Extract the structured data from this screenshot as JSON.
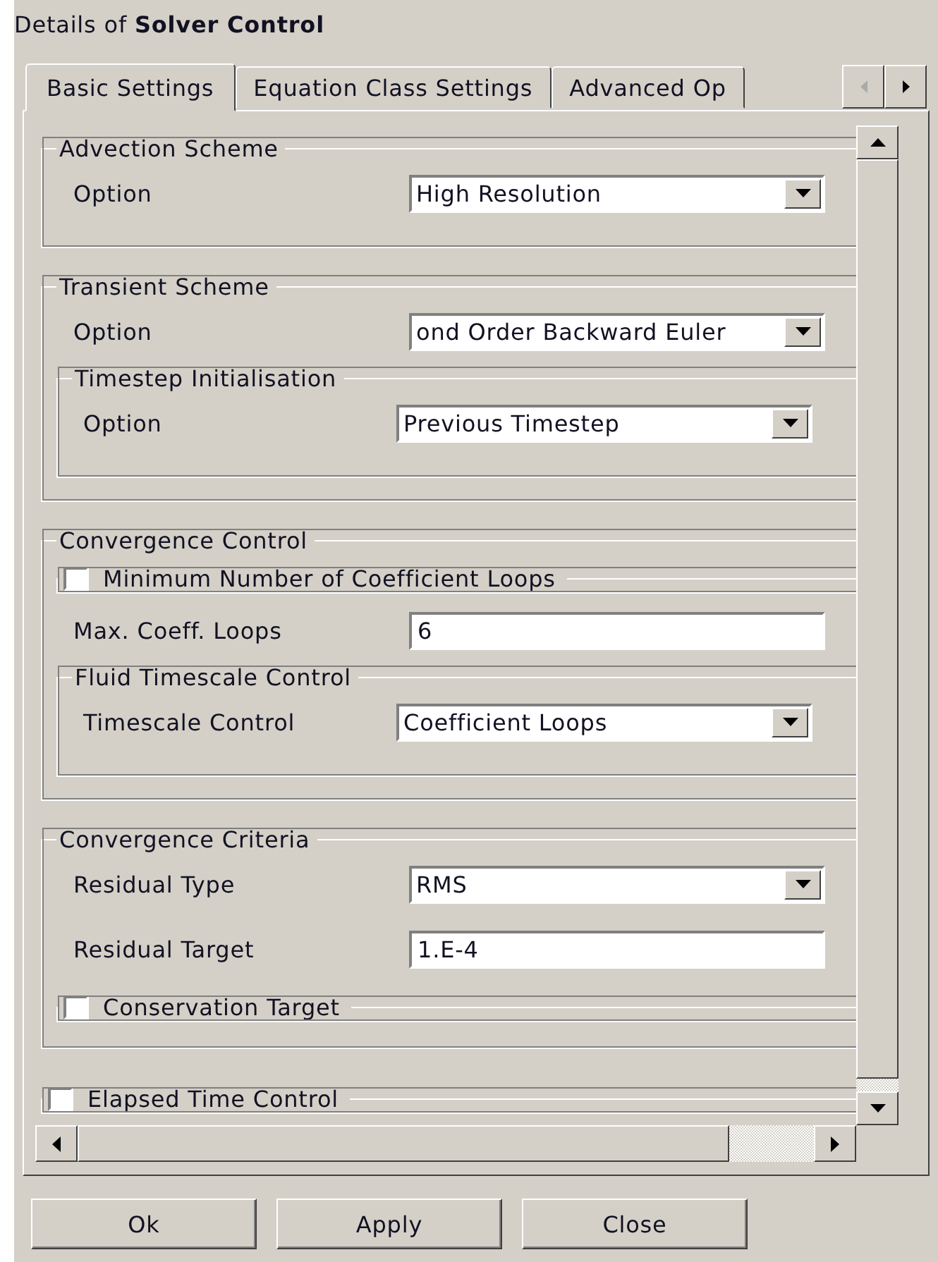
{
  "title": "Details of **Solver Control**",
  "tabs": [
    {
      "label": "Basic Settings",
      "selected": true
    },
    {
      "label": "Equation Class Settings",
      "selected": false
    },
    {
      "label": "Advanced Op",
      "selected": false
    }
  ],
  "items": [
    {
      "kind": "group",
      "title": "Advection Scheme",
      "children": [
        {
          "kind": "select",
          "label": "Option",
          "value": "High Resolution"
        }
      ]
    },
    {
      "kind": "group",
      "title": "Transient Scheme",
      "children": [
        {
          "kind": "select",
          "label": "Option",
          "value": "ond Order Backward Euler"
        },
        {
          "kind": "group",
          "title": "Timestep Initialisation",
          "children": [
            {
              "kind": "select",
              "label": "Option",
              "value": "Previous Timestep"
            }
          ]
        }
      ]
    },
    {
      "kind": "group",
      "title": "Convergence Control",
      "children": [
        {
          "kind": "checkgroup",
          "label": "Minimum Number of Coefficient Loops",
          "checked": false
        },
        {
          "kind": "input",
          "label": "Max. Coeff. Loops",
          "value": "6"
        },
        {
          "kind": "group",
          "title": "Fluid Timescale Control",
          "children": [
            {
              "kind": "select",
              "label": "Timescale Control",
              "value": "Coefficient Loops"
            }
          ]
        }
      ]
    },
    {
      "kind": "group",
      "title": "Convergence Criteria",
      "children": [
        {
          "kind": "select",
          "label": "Residual Type",
          "value": "RMS"
        },
        {
          "kind": "input",
          "label": "Residual Target",
          "value": "1.E-4"
        },
        {
          "kind": "checkgroup",
          "label": "Conservation Target",
          "checked": false
        }
      ]
    },
    {
      "kind": "checkgroup",
      "label": "Elapsed Time Control",
      "checked": false
    }
  ],
  "buttons": [
    "Ok",
    "Apply",
    "Close"
  ]
}
